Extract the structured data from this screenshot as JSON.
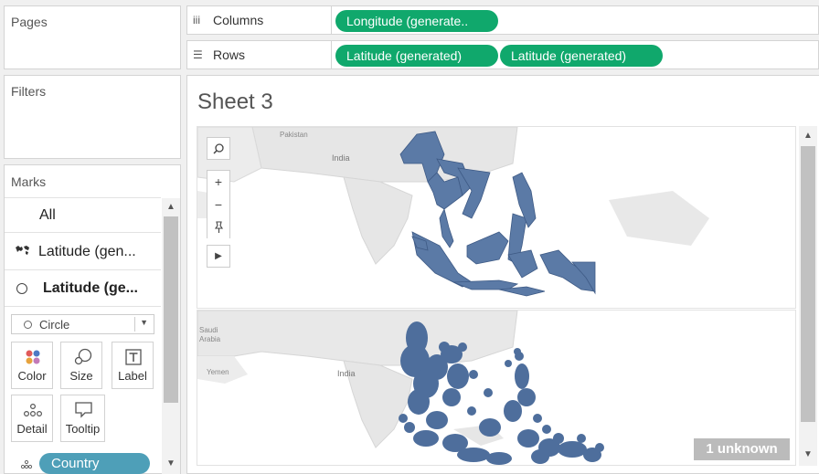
{
  "cards": {
    "pages_title": "Pages",
    "filters_title": "Filters",
    "marks_title": "Marks"
  },
  "shelves": {
    "columns_label": "Columns",
    "rows_label": "Rows",
    "columns_pills": [
      "Longitude (generate.."
    ],
    "rows_pills": [
      "Latitude (generated)",
      "Latitude (generated)"
    ]
  },
  "marks": {
    "all_label": "All",
    "layer1_label": "Latitude (gen...",
    "layer2_label": "Latitude (ge...",
    "mark_type": "Circle",
    "buttons": {
      "color": "Color",
      "size": "Size",
      "label": "Label",
      "detail": "Detail",
      "tooltip": "Tooltip"
    },
    "detail_field": "Country"
  },
  "sheet": {
    "title": "Sheet 3",
    "unknown_badge": "1 unknown",
    "map_labels": {
      "pakistan": "Pakistan",
      "india_top": "India",
      "india_bottom": "India",
      "saudi": "Saudi",
      "arabia": "Arabia",
      "yemen": "Yemen"
    }
  },
  "colors": {
    "pill_green": "#10a86c",
    "map_fill": "#5b7aa6",
    "circle_fill": "#4e6e9c",
    "detail_pill": "#4e9fb8",
    "badge_bg": "#bbbbbb"
  }
}
